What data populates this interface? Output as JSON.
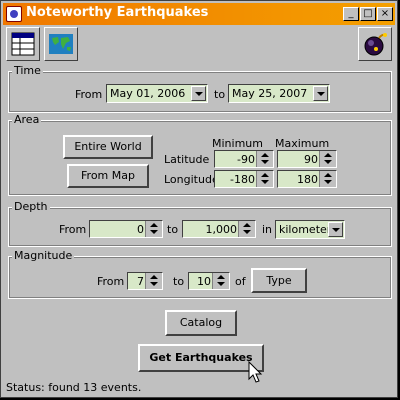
{
  "window": {
    "title": "Noteworthy Earthquakes"
  },
  "icons": {
    "toolbar_1": "table-icon",
    "toolbar_2": "world-map-icon",
    "toolbar_3": "bomb-icon"
  },
  "time": {
    "label": "Time",
    "from_label": "From",
    "from_value": "May 01, 2006",
    "to_label": "to",
    "to_value": "May 25, 2007"
  },
  "area": {
    "label": "Area",
    "entire_world": "Entire World",
    "from_map": "From Map",
    "minimum": "Minimum",
    "maximum": "Maximum",
    "latitude": "Latitude",
    "longitude": "Longitude",
    "lat_min": "-90",
    "lat_max": "90",
    "lon_min": "-180",
    "lon_max": "180"
  },
  "depth": {
    "label": "Depth",
    "from_label": "From",
    "from_value": "0",
    "to_label": "to",
    "to_value": "1,000",
    "in_label": "in",
    "unit": "kilometers"
  },
  "magnitude": {
    "label": "Magnitude",
    "from_label": "From",
    "from_value": "7",
    "to_label": "to",
    "to_value": "10",
    "of_label": "of",
    "type_button": "Type"
  },
  "actions": {
    "catalog": "Catalog",
    "get": "Get Earthquakes"
  },
  "status": "Status: found 13 events."
}
